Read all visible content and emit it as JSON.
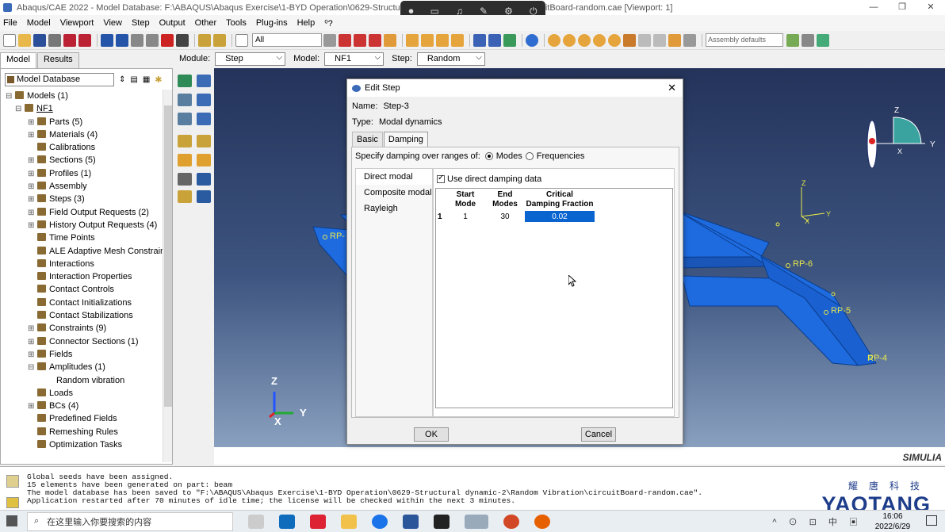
{
  "window": {
    "title": "Abaqus/CAE 2022 - Model Database: F:\\ABAQUS\\Abaqus Exercise\\1-BYD Operation\\0629-Structural dynamic-2\\Random Vibration\\circuitBoard-random.cae [Viewport: 1]",
    "controls": [
      "—",
      "❐",
      "✕"
    ]
  },
  "menu": [
    "File",
    "Model",
    "Viewport",
    "View",
    "Step",
    "Output",
    "Other",
    "Tools",
    "Plug-ins",
    "Help",
    "⁰?"
  ],
  "toolbar": {
    "selection": "All",
    "assembly_field": "Assembly defaults"
  },
  "left_tabs": [
    "Model",
    "Results"
  ],
  "context": {
    "module_label": "Module:",
    "module": "Step",
    "model_label": "Model:",
    "model": "NF1",
    "step_label": "Step:",
    "step": "Random"
  },
  "tree": {
    "database": "Model Database",
    "nodes": [
      {
        "label": "Models (1)",
        "indent": 0,
        "exp": "⊟"
      },
      {
        "label": "NF1",
        "indent": 1,
        "exp": "⊟"
      },
      {
        "label": "Parts (5)",
        "indent": 2,
        "exp": "⊞"
      },
      {
        "label": "Materials (4)",
        "indent": 2,
        "exp": "⊞"
      },
      {
        "label": "Calibrations",
        "indent": 2,
        "exp": ""
      },
      {
        "label": "Sections (5)",
        "indent": 2,
        "exp": "⊞"
      },
      {
        "label": "Profiles (1)",
        "indent": 2,
        "exp": "⊞"
      },
      {
        "label": "Assembly",
        "indent": 2,
        "exp": "⊞"
      },
      {
        "label": "Steps (3)",
        "indent": 2,
        "exp": "⊞"
      },
      {
        "label": "Field Output Requests (2)",
        "indent": 2,
        "exp": "⊞"
      },
      {
        "label": "History Output Requests (4)",
        "indent": 2,
        "exp": "⊞"
      },
      {
        "label": "Time Points",
        "indent": 2,
        "exp": ""
      },
      {
        "label": "ALE Adaptive Mesh Constraints",
        "indent": 2,
        "exp": ""
      },
      {
        "label": "Interactions",
        "indent": 2,
        "exp": ""
      },
      {
        "label": "Interaction Properties",
        "indent": 2,
        "exp": ""
      },
      {
        "label": "Contact Controls",
        "indent": 2,
        "exp": ""
      },
      {
        "label": "Contact Initializations",
        "indent": 2,
        "exp": ""
      },
      {
        "label": "Contact Stabilizations",
        "indent": 2,
        "exp": ""
      },
      {
        "label": "Constraints (9)",
        "indent": 2,
        "exp": "⊞"
      },
      {
        "label": "Connector Sections (1)",
        "indent": 2,
        "exp": "⊞"
      },
      {
        "label": "Fields",
        "indent": 2,
        "exp": "⊞"
      },
      {
        "label": "Amplitudes (1)",
        "indent": 2,
        "exp": "⊟"
      },
      {
        "label": "Random vibration",
        "indent": 3,
        "exp": ""
      },
      {
        "label": "Loads",
        "indent": 2,
        "exp": ""
      },
      {
        "label": "BCs (4)",
        "indent": 2,
        "exp": "⊞"
      },
      {
        "label": "Predefined Fields",
        "indent": 2,
        "exp": ""
      },
      {
        "label": "Remeshing Rules",
        "indent": 2,
        "exp": ""
      },
      {
        "label": "Optimization Tasks",
        "indent": 2,
        "exp": ""
      }
    ]
  },
  "viewport": {
    "rp_labels": [
      "RP-",
      "RP-6",
      "RP-5",
      "RP-4"
    ],
    "triad": {
      "z": "Z",
      "y": "Y",
      "x": "X"
    },
    "brand": "SIMULIA"
  },
  "dialog": {
    "title": "Edit Step",
    "name_label": "Name:",
    "name": "Step-3",
    "type_label": "Type:",
    "type": "Modal dynamics",
    "tabs": [
      "Basic",
      "Damping"
    ],
    "specify_label": "Specify damping over ranges of:",
    "opt_modes": "Modes",
    "opt_freq": "Frequencies",
    "methods": [
      "Direct modal",
      "Composite modal",
      "Rayleigh"
    ],
    "use_direct": "Use direct damping data",
    "table": {
      "headers": [
        [
          "Start",
          "Mode"
        ],
        [
          "End",
          "Modes"
        ],
        [
          "Critical",
          "Damping Fraction"
        ]
      ],
      "rows": [
        {
          "n": "1",
          "start": "1",
          "end": "30",
          "frac": "0.02"
        }
      ]
    },
    "ok": "OK",
    "cancel": "Cancel"
  },
  "messages": [
    "Global seeds have been assigned.",
    "15 elements have been generated on part: beam",
    "The model database has been saved to \"F:\\ABAQUS\\Abaqus Exercise\\1-BYD Operation\\0629-Structural dynamic-2\\Random Vibration\\circuitBoard-random.cae\".",
    "Application restarted after 70 minutes of idle time; the license will be checked within the next 3 minutes."
  ],
  "watermark": {
    "cn": "耀唐科技",
    "en": "YAOTANG"
  },
  "taskbar": {
    "search_placeholder": "在这里输入你要搜索的内容",
    "tray": "^ ⊙ ⊡ 中 ▣",
    "time": "16:06",
    "date": "2022/6/29"
  },
  "colors": {
    "part_blue": "#1e6be0",
    "selection": "#0a64d0",
    "viewport_top": "#24335a",
    "viewport_bottom": "#8aa0bf"
  }
}
